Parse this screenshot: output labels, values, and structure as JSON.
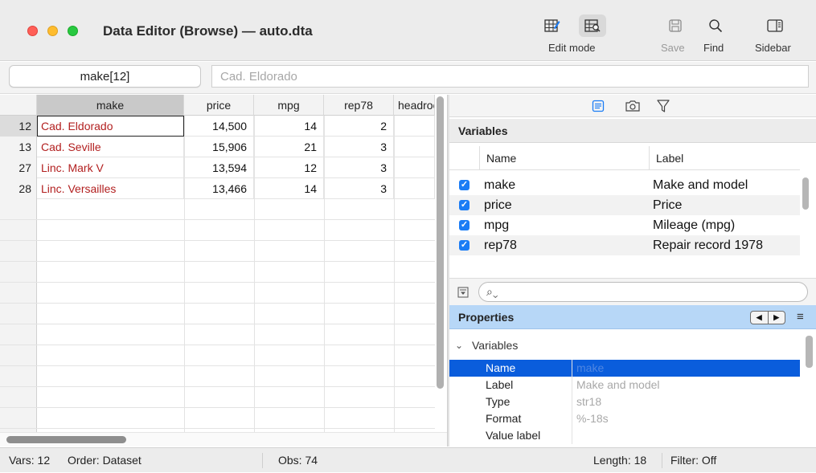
{
  "window": {
    "title": "Data Editor (Browse) — auto.dta"
  },
  "toolbar": {
    "edit_mode_label": "Edit mode",
    "save_label": "Save",
    "find_label": "Find",
    "sidebar_label": "Sidebar",
    "edit_mode_selected": "browse"
  },
  "namebar": {
    "cell_ref": "make[12]",
    "cell_value": "Cad. Eldorado"
  },
  "grid": {
    "columns": [
      "make",
      "price",
      "mpg",
      "rep78",
      "headroom"
    ],
    "selected_column": "make",
    "rows": [
      {
        "obs": "12",
        "make": "Cad. Eldorado",
        "price": "14,500",
        "mpg": "14",
        "rep78": "2"
      },
      {
        "obs": "13",
        "make": "Cad. Seville",
        "price": "15,906",
        "mpg": "21",
        "rep78": "3"
      },
      {
        "obs": "27",
        "make": "Linc. Mark V",
        "price": "13,594",
        "mpg": "12",
        "rep78": "3"
      },
      {
        "obs": "28",
        "make": "Linc. Versailles",
        "price": "13,466",
        "mpg": "14",
        "rep78": "3"
      }
    ],
    "active_row": "12"
  },
  "variables": {
    "section_title": "Variables",
    "col_name": "Name",
    "col_label": "Label",
    "items": [
      {
        "name": "make",
        "label": "Make and model",
        "checked": true
      },
      {
        "name": "price",
        "label": "Price",
        "checked": true
      },
      {
        "name": "mpg",
        "label": "Mileage (mpg)",
        "checked": true
      },
      {
        "name": "rep78",
        "label": "Repair record 1978",
        "checked": true
      }
    ]
  },
  "properties": {
    "section_title": "Properties",
    "group": "Variables",
    "rows": [
      {
        "key": "Name",
        "value": "make",
        "selected": true
      },
      {
        "key": "Label",
        "value": "Make and model"
      },
      {
        "key": "Type",
        "value": "str18"
      },
      {
        "key": "Format",
        "value": "%-18s"
      },
      {
        "key": "Value label",
        "value": ""
      }
    ]
  },
  "status": {
    "vars": "Vars: 12",
    "order": "Order: Dataset",
    "obs": "Obs: 74",
    "length": "Length: 18",
    "filter": "Filter: Off"
  },
  "colors": {
    "string_text": "#b21f1f",
    "selection_blue": "#0a5ddc",
    "properties_header": "#b7d7f7",
    "checkbox": "#1a7cf5"
  },
  "icons": {
    "edit_mode": "table-pencil-icon",
    "browse_mode": "table-search-icon",
    "save": "floppy-disk-icon",
    "find": "magnifier-icon",
    "sidebar": "sidebar-panel-icon",
    "variables_panel": "list-icon",
    "snapshot": "camera-icon",
    "filter": "funnel-icon"
  }
}
